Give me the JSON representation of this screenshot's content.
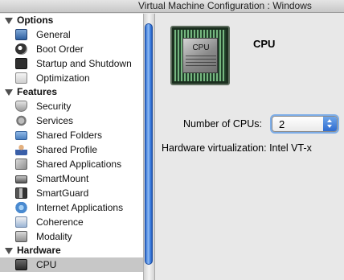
{
  "window": {
    "title": "Virtual Machine Configuration : Windows"
  },
  "sidebar": {
    "sections": [
      {
        "label": "Options",
        "items": [
          {
            "label": "General",
            "icon": "general-icon"
          },
          {
            "label": "Boot Order",
            "icon": "boot-order-icon"
          },
          {
            "label": "Startup and Shutdown",
            "icon": "startup-shutdown-icon"
          },
          {
            "label": "Optimization",
            "icon": "optimization-icon"
          }
        ]
      },
      {
        "label": "Features",
        "items": [
          {
            "label": "Security",
            "icon": "shield-icon"
          },
          {
            "label": "Services",
            "icon": "services-gear-icon"
          },
          {
            "label": "Shared Folders",
            "icon": "folder-icon"
          },
          {
            "label": "Shared Profile",
            "icon": "user-icon"
          },
          {
            "label": "Shared Applications",
            "icon": "applications-icon"
          },
          {
            "label": "SmartMount",
            "icon": "drive-icon"
          },
          {
            "label": "SmartGuard",
            "icon": "smartguard-icon"
          },
          {
            "label": "Internet Applications",
            "icon": "globe-icon"
          },
          {
            "label": "Coherence",
            "icon": "coherence-icon"
          },
          {
            "label": "Modality",
            "icon": "modality-icon"
          }
        ]
      },
      {
        "label": "Hardware",
        "items": [
          {
            "label": "CPU",
            "icon": "cpu-icon",
            "selected": true
          }
        ]
      }
    ]
  },
  "main": {
    "title": "CPU",
    "chip_label": "CPU",
    "cpus_label": "Number of CPUs:",
    "cpus_value": "2",
    "hardware_virtualization": "Hardware virtualization: Intel VT-x"
  },
  "colors": {
    "selection": "#c7c7c7",
    "scroll_thumb": "#3778dd",
    "focus_ring": "#7eaee8"
  }
}
